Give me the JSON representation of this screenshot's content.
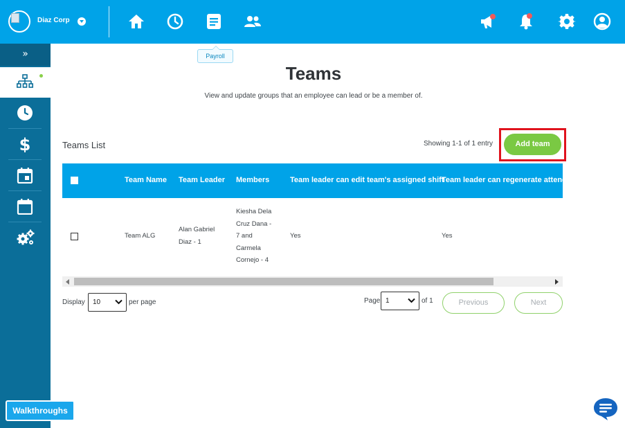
{
  "header": {
    "company_name": "Diaz Corp",
    "nav": [
      {
        "name": "home",
        "icon": "home-icon"
      },
      {
        "name": "time",
        "icon": "clock-icon"
      },
      {
        "name": "payroll",
        "icon": "document-icon",
        "tooltip": "Payroll"
      },
      {
        "name": "people",
        "icon": "people-icon"
      }
    ],
    "right_icons": [
      "megaphone-icon",
      "bell-icon",
      "gear-icon",
      "user-icon"
    ],
    "brand_color": "#00a3e8"
  },
  "sidebar": {
    "toggle_label": "»",
    "items": [
      {
        "icon": "org-chart-icon",
        "active": true
      },
      {
        "icon": "clock-icon"
      },
      {
        "icon": "dollar-icon"
      },
      {
        "icon": "calendar-icon"
      },
      {
        "icon": "calendar-empty-icon"
      },
      {
        "icon": "gears-icon"
      }
    ],
    "walkthrough_label": "Walkthroughs"
  },
  "page": {
    "title": "Teams",
    "subtitle": "View and update groups that an employee can lead or be a member of."
  },
  "teams_list": {
    "title": "Teams List",
    "entry_count": "Showing 1-1 of 1 entry",
    "add_button": "Add team",
    "columns": [
      "Team Name",
      "Team Leader",
      "Members",
      "Team leader can edit team's assigned shift",
      "Team leader can regenerate attendanc"
    ],
    "rows": [
      {
        "team_name": "Team ALG",
        "team_leader": [
          "Alan Gabriel",
          "Diaz - 1"
        ],
        "members": [
          "Kiesha Dela",
          "Cruz Dana -",
          "7 and",
          "Carmela",
          "Cornejo - 4"
        ],
        "can_edit_shift": "Yes",
        "can_regenerate": "Yes"
      }
    ]
  },
  "pagination": {
    "display_label": "Display",
    "per_page_value": "10",
    "per_page_label": "per page",
    "page_label": "Page",
    "page_value": "1",
    "of_label": "of 1",
    "previous": "Previous",
    "next": "Next"
  },
  "colors": {
    "accent_green": "#7ac943",
    "highlight_red": "#e0121d",
    "sidebar": "#0b6e99"
  }
}
